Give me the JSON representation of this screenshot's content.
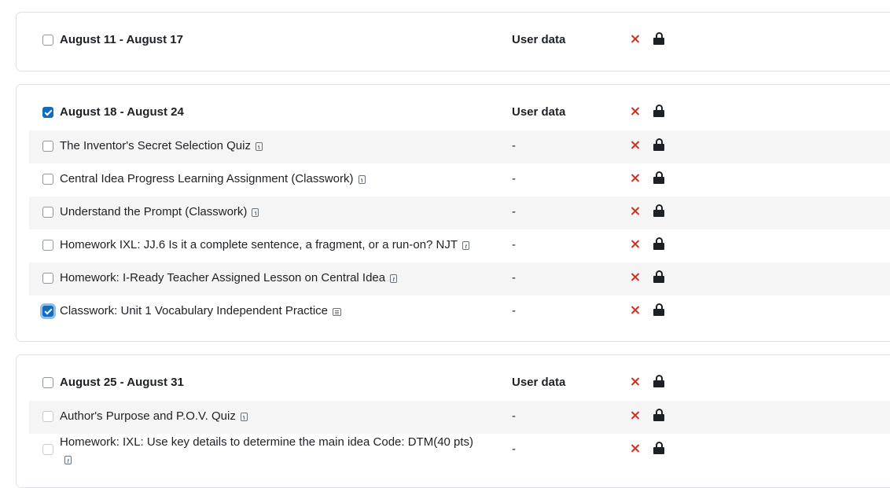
{
  "columns": {
    "user_data": "User data",
    "empty_value": "-"
  },
  "sections": [
    {
      "title": "August 11 - August 17",
      "checked": false,
      "items": []
    },
    {
      "title": "August 18 - August 24",
      "checked": true,
      "items": [
        {
          "label": "The Inventor's Secret Selection Quiz",
          "icon": "assignment-icon",
          "checked": false
        },
        {
          "label": "Central Idea Progress Learning Assignment (Classwork)",
          "icon": "assignment-icon",
          "checked": false
        },
        {
          "label": "Understand the Prompt (Classwork)",
          "icon": "assignment-icon",
          "checked": false
        },
        {
          "label": "Homework IXL: JJ.6 Is it a complete sentence, a fragment, or a run-on? NJT",
          "icon": "assignment-icon",
          "checked": false
        },
        {
          "label": "Homework: I-Ready Teacher Assigned Lesson on Central Idea",
          "icon": "assignment-icon",
          "checked": false
        },
        {
          "label": "Classwork: Unit 1 Vocabulary Independent Practice",
          "icon": "page-icon",
          "checked": true,
          "focused": true
        }
      ]
    },
    {
      "title": "August 25 - August 31",
      "checked": false,
      "items": [
        {
          "label": "Author's Purpose and P.O.V. Quiz",
          "icon": "assignment-icon",
          "checked": false
        },
        {
          "label": "Homework: IXL: Use key details to determine the main idea Code: DTM(40 pts)",
          "icon": "assignment-icon",
          "checked": false
        }
      ]
    }
  ],
  "colors": {
    "accent": "#0f6cbf",
    "delete": "#ca3120",
    "row_shade": "#f5f5f5",
    "border": "#dee2e6"
  }
}
